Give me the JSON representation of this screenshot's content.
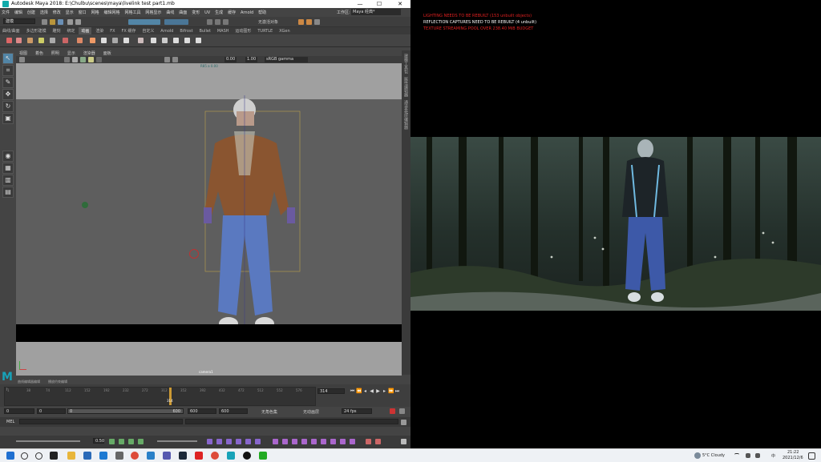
{
  "maya": {
    "window_title": "Autodesk Maya 2018: E:\\Chulbu\\scenes\\maya\\livelink test part1.mb",
    "window_controls": [
      "—",
      "☐",
      "✕"
    ],
    "menus": [
      "文件",
      "编辑",
      "创建",
      "选择",
      "修改",
      "显示",
      "窗口",
      "网格",
      "编辑网格",
      "网格工具",
      "网格显示",
      "曲线",
      "曲面",
      "变形",
      "UV",
      "生成",
      "缓存",
      "Arnold",
      "帮助"
    ],
    "workspace_label": "工作区:",
    "workspace_value": "Maya 经典*",
    "mode_menu": "建模",
    "status_text": "无激活对象",
    "shelf_tabs": [
      "曲线/曲面",
      "多边形建模",
      "雕刻",
      "绑定",
      "动画",
      "渲染",
      "FX",
      "FX 缓存",
      "自定义",
      "Arnold",
      "Bifrost",
      "Bullet",
      "MASH",
      "运动图形",
      "TURTLE",
      "XGen"
    ],
    "shelf_active_index": 4,
    "viewport_menus": [
      "视图",
      "着色",
      "照明",
      "显示",
      "渲染器",
      "面板"
    ],
    "viewport_fields": {
      "exposure": "0.00",
      "gamma": "1.00",
      "colorspace": "sRGB gamma"
    },
    "hud_top": "R85 a 0.00",
    "camera_label": "camera1",
    "right_panel_tabs": [
      "建模工具包",
      "属性编辑器",
      "通道盒/层编辑器"
    ],
    "timeline_tabs": [
      "曲线编辑器编辑",
      "播放约束编辑"
    ],
    "timeline_ticks": [
      "1",
      "38",
      "74",
      "112",
      "152",
      "192",
      "232",
      "272",
      "312",
      "352",
      "392",
      "432",
      "472",
      "512",
      "552",
      "576"
    ],
    "current_frame_marker": "314",
    "current_frame_field": "314",
    "range": {
      "start_outer": "0",
      "start_inner": "0",
      "slider_label": "0",
      "end_inner": "600",
      "end_outer": "600",
      "end_outer2": "600"
    },
    "character_set": "无角色集",
    "anim_layer": "无动画层",
    "fps": "24 fps",
    "command_label": "MEL",
    "blend_value": "0.50"
  },
  "unreal": {
    "messages": [
      {
        "text": "LIGHTING NEEDS TO BE REBUILT (153 unbuilt objects)",
        "color": "#e02020"
      },
      {
        "text": "REFLECTION CAPTURES NEED TO BE REBUILT (4 unbuilt)",
        "color": "#ffffff"
      },
      {
        "text": "TEXTURE STREAMING POOL OVER 238.40 MiB BUDGET",
        "color": "#e02020"
      }
    ]
  },
  "taskbar": {
    "weather": "5°C Cloudy",
    "time": "21:22",
    "date": "2021/12/6",
    "lang": "中",
    "icons": [
      "windows-start",
      "search",
      "task-view",
      "file-explorer",
      "mail",
      "store",
      "edge",
      "chrome",
      "app-blue",
      "app-teams",
      "steam",
      "app-red",
      "chrome-2",
      "maya",
      "unreal",
      "app-green"
    ]
  }
}
